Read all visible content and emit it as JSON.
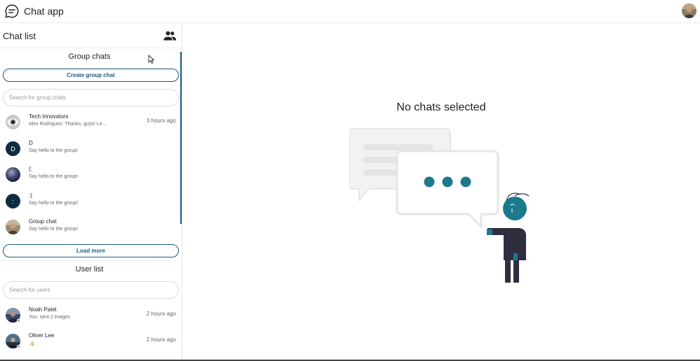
{
  "header": {
    "app_title": "Chat app",
    "logo_icon": "chat-bubble-icon"
  },
  "sidebar": {
    "title": "Chat list",
    "people_icon": "people-icon",
    "group_section": {
      "title": "Group chats",
      "create_label": "Create group chat",
      "search_placeholder": "Search for group chats",
      "items": [
        {
          "name": "Tech Innovators",
          "preview": "Alex Rodriguez: Thanks, guys! Le...",
          "time": "3 hours ago",
          "initial": ""
        },
        {
          "name": "D",
          "preview": "Say hello to the group!",
          "time": "",
          "initial": "D"
        },
        {
          "name": "(:",
          "preview": "Say hello to the group!",
          "time": "",
          "initial": ""
        },
        {
          "name": ":)",
          "preview": "Say hello to the group!",
          "time": "",
          "initial": ":"
        },
        {
          "name": "Group chat",
          "preview": "Say hello to the group!",
          "time": "",
          "initial": ""
        }
      ],
      "load_more_label": "Load more"
    },
    "user_section": {
      "title": "User list",
      "search_placeholder": "Search for users",
      "items": [
        {
          "name": "Noah Patel",
          "preview": "You: sent 2 images",
          "time": "2 hours ago"
        },
        {
          "name": "Oliver Lee",
          "preview": "👍🏻",
          "time": "2 hours ago"
        }
      ]
    }
  },
  "main": {
    "empty_title": "No chats selected"
  },
  "colors": {
    "accent": "#1a5a7a",
    "teal": "#1b7a8c",
    "dark_avatar": "#0f2d40"
  }
}
